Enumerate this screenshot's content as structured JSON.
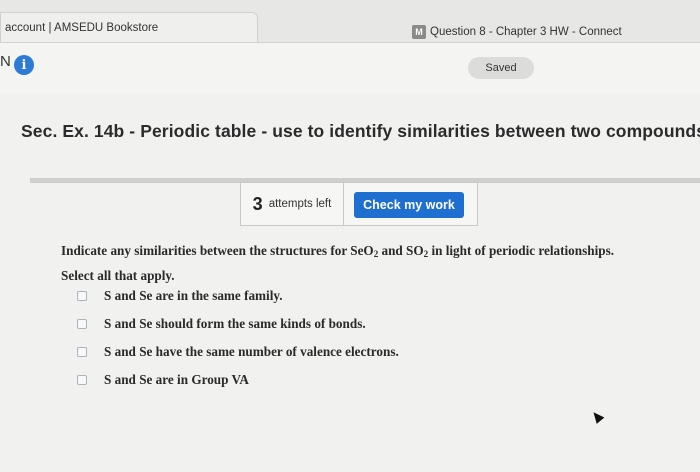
{
  "tabs": {
    "tab1_label": "account | AMSEDU Bookstore",
    "tab2_badge": "M",
    "tab2_label": "Question 8 - Chapter 3 HW - Connect"
  },
  "nav": {
    "partial_letter": "N",
    "info_icon": "i",
    "saved_label": "Saved"
  },
  "title": "Sec. Ex. 14b - Periodic table - use to identify similarities between two compounds",
  "attempts": {
    "count": "3",
    "label": "attempts left",
    "check_button": "Check my work"
  },
  "question": {
    "part1": "Indicate any similarities between the structures for SeO",
    "sub1": "2",
    "part2": " and SO",
    "sub2": "2",
    "part3": " in light of periodic relationships.",
    "line2": "Select all that apply."
  },
  "options": [
    "S and Se are in the same family.",
    "S and Se should form the same kinds of bonds.",
    "S and Se have the same number of valence electrons.",
    "S and Se are in Group VA"
  ],
  "icons": {
    "info": "info-icon",
    "cursor": "mouse-cursor-icon"
  },
  "colors": {
    "accent": "#1f6fd1",
    "info": "#2c7bd6"
  }
}
